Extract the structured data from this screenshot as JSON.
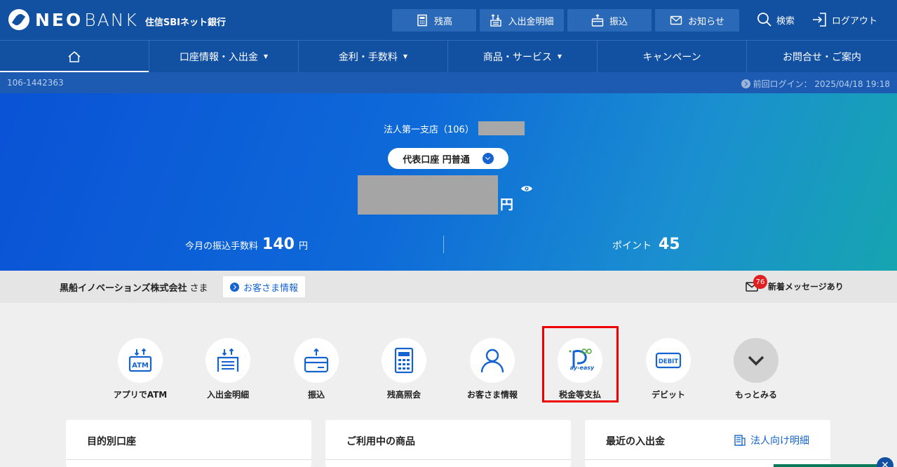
{
  "brand": {
    "neo": "NEO",
    "bank": "BANK",
    "sub": "住信SBIネット銀行"
  },
  "header": {
    "buttons": [
      {
        "label": "残高",
        "icon": "calculator-icon"
      },
      {
        "label": "入出金明細",
        "icon": "transfer-arrows-icon"
      },
      {
        "label": "振込",
        "icon": "card-icon"
      },
      {
        "label": "お知らせ",
        "icon": "mail-icon"
      }
    ],
    "search": "検索",
    "logout": "ログアウト"
  },
  "nav": {
    "home_icon": "home-icon",
    "items": [
      "口座情報・入出金",
      "金利・手数料",
      "商品・サービス",
      "キャンペーン",
      "お問合せ・ご案内"
    ]
  },
  "infobar": {
    "account_number": "106-1442363",
    "last_login": "前回ログイン： 2025/04/18 19:18"
  },
  "hero": {
    "branch": "法人第一支店（106）",
    "account_select": "代表口座 円普通",
    "yen": "円",
    "fee_label": "今月の振込手数料",
    "fee_value": "140",
    "fee_unit": "円",
    "points_label": "ポイント",
    "points_value": "45"
  },
  "customer": {
    "company": "黒船イノベーションズ株式会社",
    "sama": "さま",
    "info_button": "お客さま情報",
    "message_badge": "76",
    "message_text": "新着メッセージあり"
  },
  "quick_menu": [
    {
      "label": "アプリでATM",
      "icon": "atm-icon"
    },
    {
      "label": "入出金明細",
      "icon": "statement-icon"
    },
    {
      "label": "振込",
      "icon": "transfer-card-icon"
    },
    {
      "label": "残高照会",
      "icon": "calculator-icon"
    },
    {
      "label": "お客さま情報",
      "icon": "person-icon"
    },
    {
      "label": "税金等支払",
      "icon": "pay-easy-icon"
    },
    {
      "label": "デビット",
      "icon": "debit-icon"
    },
    {
      "label": "もっとみる",
      "icon": "chevron-down-icon"
    }
  ],
  "cards": {
    "purpose": "目的別口座",
    "products": "ご利用中の商品",
    "recent": "最近の入出金",
    "recent_link": "法人向け明細"
  },
  "colors": {
    "primary": "#1250a2",
    "accent": "#1463d0",
    "highlight": "#ee0000"
  }
}
